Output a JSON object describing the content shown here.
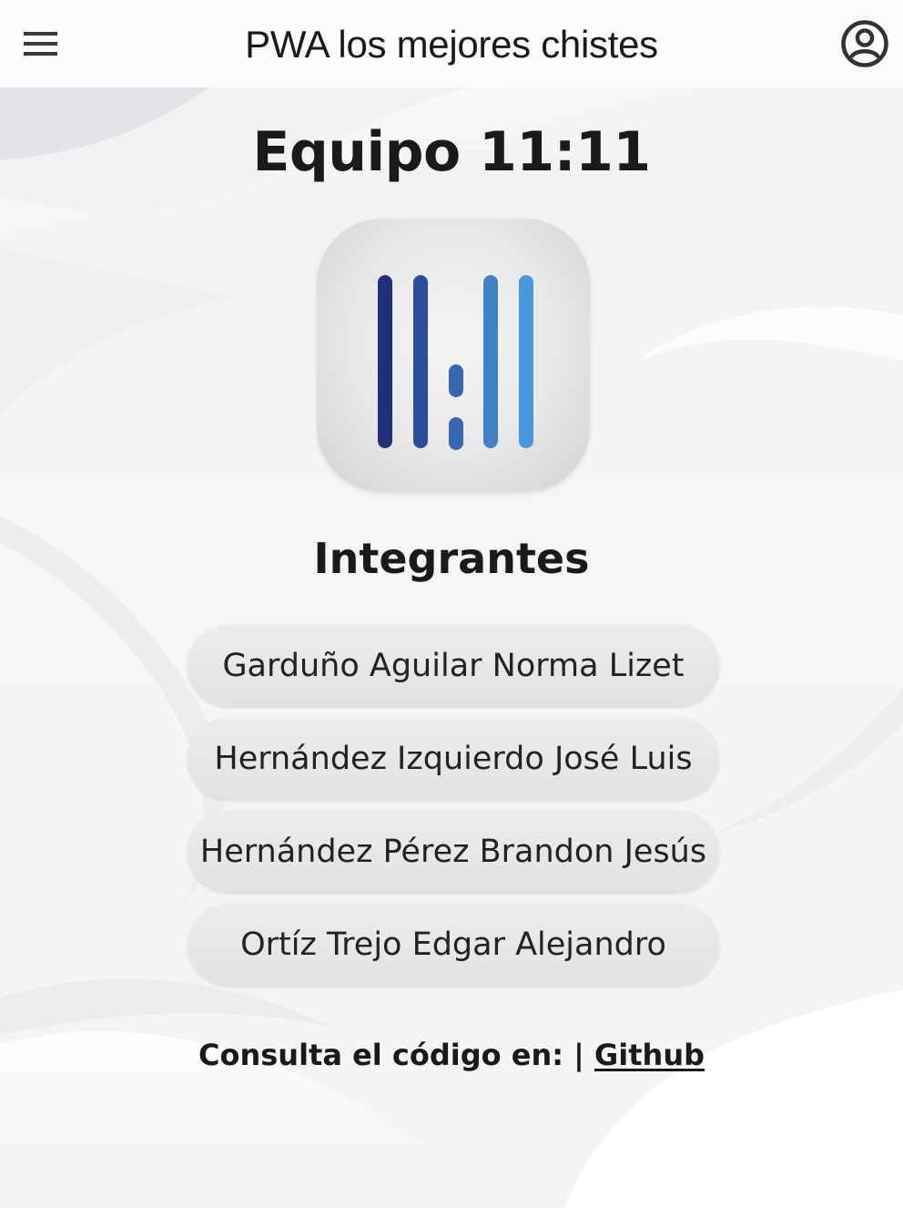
{
  "toolbar": {
    "title": "PWA los mejores chistes",
    "menu_icon": "menu-icon",
    "profile_icon": "account-circle-icon"
  },
  "main": {
    "title": "Equipo 11:11",
    "logo": {
      "name": "11:11 logo",
      "bar_colors": [
        "#1f2f7a",
        "#2c4c9c",
        "#3569b4",
        "#3f82c6",
        "#4899dc"
      ]
    },
    "section_title": "Integrantes",
    "members": [
      "Garduño Aguilar Norma Lizet",
      "Hernández Izquierdo José Luis",
      "Hernández Pérez Brandon Jesús",
      "Ortíz Trejo Edgar Alejandro"
    ],
    "footer": {
      "prefix": "Consulta el código en:",
      "separator": "|",
      "link_label": "Github"
    }
  },
  "colors": {
    "toolbar_bg": "#fbfafc",
    "text": "#1a1a1a",
    "chip_bg": "#e6e6e6"
  }
}
